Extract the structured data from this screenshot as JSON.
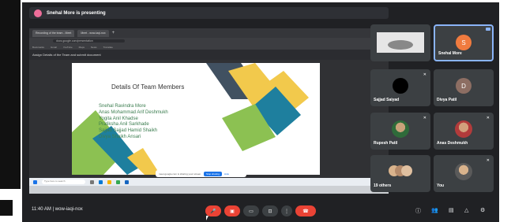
{
  "meeting": {
    "banner_text": "Snehal More is presenting",
    "time_code": "11:40 AM | wow-iaqi-nox"
  },
  "browser": {
    "tabs": [
      "Recording of the team - Meet",
      "Meet - wow-iaqi-nox",
      "+"
    ],
    "url": "docs.google.com/presentation",
    "bookmarks": [
      "Bookmarks",
      "Gmail",
      "YouTube",
      "Maps",
      "News",
      "Translate"
    ],
    "doc_title": "Assign Details of the Team and submit document"
  },
  "slide": {
    "title": "Details Of Team Members",
    "members": [
      "Snehal Ravindra More",
      "Anas Mohammad Arif Deshmukh",
      "Yogita Anil Khadse",
      "Pratiksha Anil Sarkhade",
      "Sajjad Sajjad Hamid Shaikh",
      "Divya Shaikh Ansari"
    ]
  },
  "share_controls": {
    "text": "meet.google.com is sharing your screen.",
    "stop_label": "Stop sharing",
    "hide_label": "Hide"
  },
  "taskbar": {
    "search_placeholder": "Type here to search"
  },
  "participants": [
    {
      "name": "",
      "kind": "thumb"
    },
    {
      "name": "Snehal More",
      "initial": "S",
      "color": "#f07b3f",
      "active": true
    },
    {
      "name": "Sajjad Saiyad",
      "kind": "black"
    },
    {
      "name": "Divya Patil",
      "initial": "D",
      "color": "#8d6e63"
    },
    {
      "name": "Rupesh Patil",
      "kind": "photo"
    },
    {
      "name": "Anas Deshmukh",
      "kind": "photo"
    },
    {
      "name": "19 others",
      "kind": "group"
    },
    {
      "name": "You",
      "kind": "photo"
    }
  ],
  "colors": {
    "meet_bg": "#202124",
    "tile_bg": "#3c4043",
    "active_border": "#8ab4f8",
    "end_call": "#ea4335",
    "slide_green": "#3b7d4f",
    "shape_yellow": "#f2c94c",
    "shape_blue": "#1e7f9e",
    "shape_green": "#8cc152"
  }
}
